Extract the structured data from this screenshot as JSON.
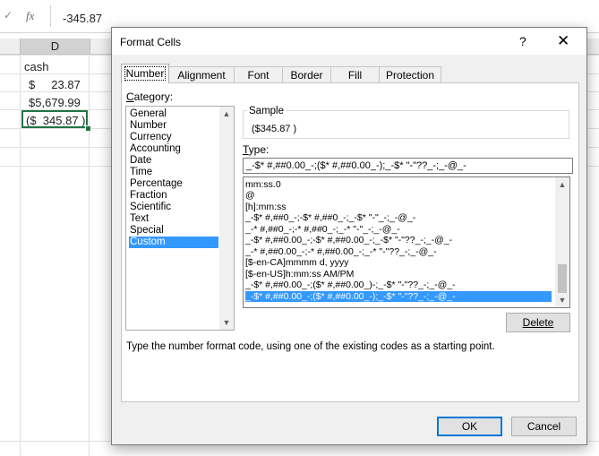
{
  "formula_bar": {
    "check_icon": "check-icon",
    "fx_label": "fx",
    "value": "-345.87"
  },
  "sheet": {
    "column_header": "D",
    "cells": [
      "cash",
      "$     23.87",
      "$5,679.99",
      "($  345.87 )"
    ]
  },
  "dialog": {
    "title": "Format Cells",
    "help": "?",
    "close": "✕",
    "tabs": [
      "Number",
      "Alignment",
      "Font",
      "Border",
      "Fill",
      "Protection"
    ],
    "active_tab": "Number",
    "category_label": "Category:",
    "categories": [
      "General",
      "Number",
      "Currency",
      "Accounting",
      "Date",
      "Time",
      "Percentage",
      "Fraction",
      "Scientific",
      "Text",
      "Special",
      "Custom"
    ],
    "selected_category": "Custom",
    "sample_label": "Sample",
    "sample_value": "($345.87 )",
    "type_label": "Type:",
    "type_value": "_-$* #,##0.00_-;($* #,##0.00_-);_-$* \"-\"??_-;_-@_-",
    "type_list": [
      "mm:ss.0",
      "@",
      "[h]:mm:ss",
      "_-$* #,##0_-;-$* #,##0_-;_-$* \"-\"_-;_-@_-",
      "_-* #,##0_-;-* #,##0_-;_-* \"-\"_-;_-@_-",
      "_-$* #,##0.00_-;-$* #,##0.00_-;_-$* \"-\"??_-;_-@_-",
      "_-* #,##0.00_-;-* #,##0.00_-;_-* \"-\"??_-;_-@_-",
      "[$-en-CA]mmmm d, yyyy",
      "[$-en-US]h:mm:ss AM/PM",
      "_-$* #,##0.00_-;($* #,##0.00_)-;_-$* \"-\"??_-;_-@_-",
      "_-$* #,##0.00_-;($* #,##0.00_-);_-$* \"-\"??_-;_-@_-"
    ],
    "selected_type_index": 10,
    "delete_button": "Delete",
    "description": "Type the number format code, using one of the existing codes as a starting point.",
    "ok_button": "OK",
    "cancel_button": "Cancel"
  }
}
